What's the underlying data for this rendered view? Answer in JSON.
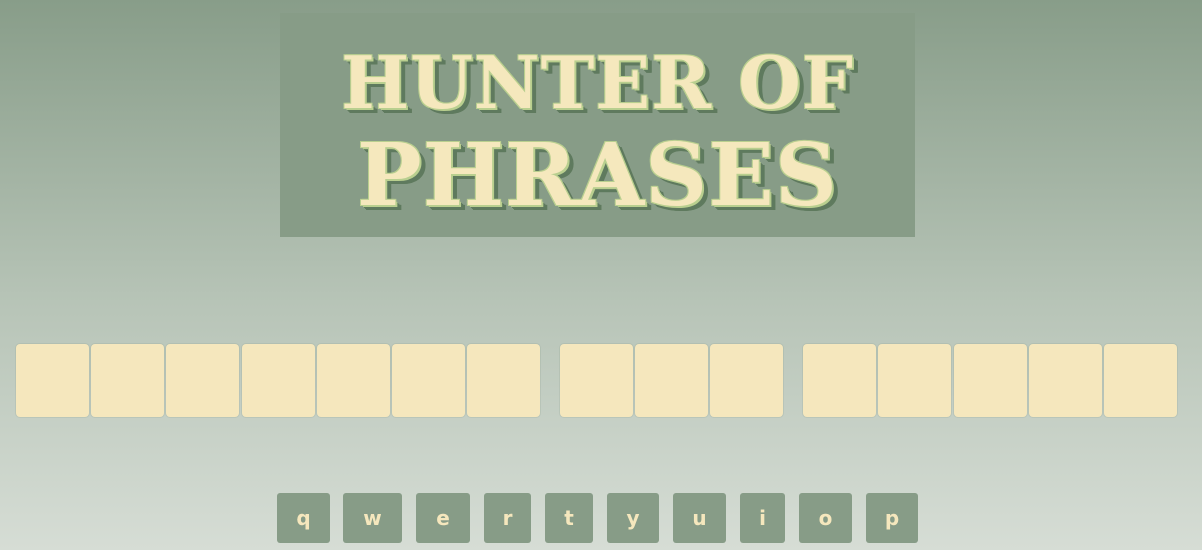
{
  "title": {
    "line1": "HUNTER OF",
    "line2": "PHRASES"
  },
  "board": {
    "words": [
      7,
      3,
      5
    ],
    "letters": [
      "",
      "",
      "",
      "",
      "",
      "",
      "",
      "",
      "",
      "",
      "",
      "",
      "",
      "",
      ""
    ]
  },
  "keyboard": {
    "row1": [
      "q",
      "w",
      "e",
      "r",
      "t",
      "y",
      "u",
      "i",
      "o",
      "p"
    ]
  },
  "colors": {
    "background_top": "#889d89",
    "background_bottom": "#d6ddd5",
    "tile": "#f5e7bd",
    "key": "#879c87",
    "title_fill": "#f5e8bd",
    "title_outline": "#b9cf8f",
    "title_shadow": "#5f7a5e"
  }
}
